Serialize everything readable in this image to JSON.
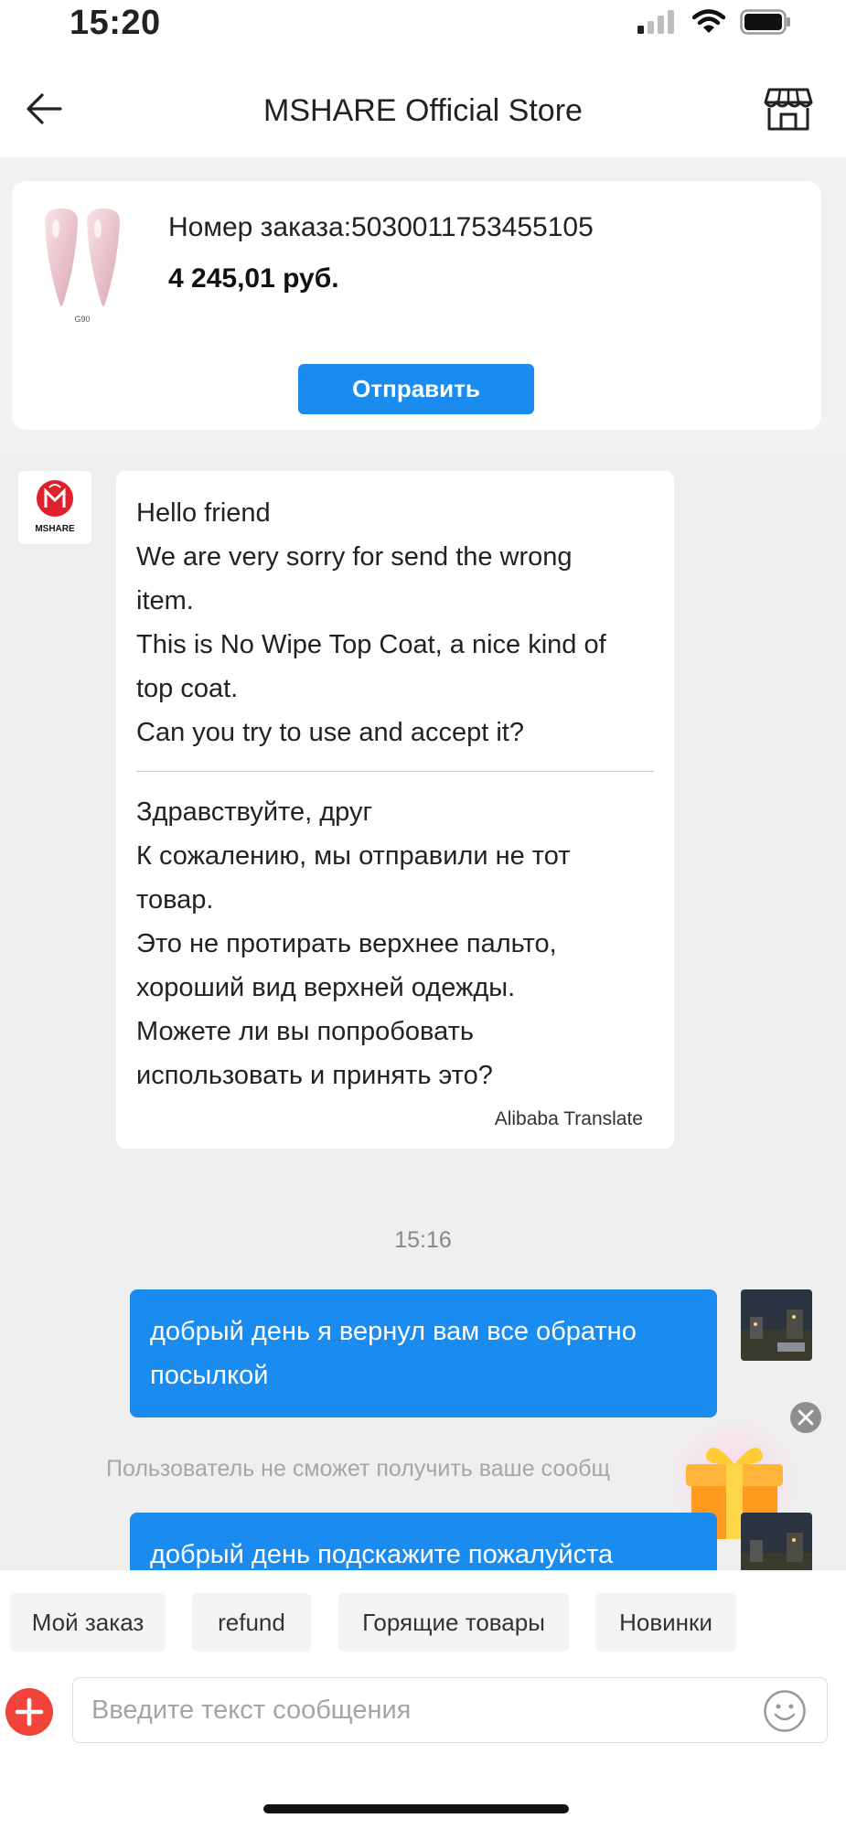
{
  "status_bar": {
    "time": "15:20"
  },
  "header": {
    "title": "MSHARE Official Store"
  },
  "order": {
    "thumb_caption": "G90",
    "number_label": "Номер заказа:5030011753455105",
    "price": "4 245,01 руб.",
    "send_label": "Отправить"
  },
  "seller": {
    "avatar_text": "MSHARE",
    "message": {
      "original": [
        "Hello friend",
        "We are very sorry for send the wrong",
        "item.",
        "This is No Wipe Top Coat, a nice kind of",
        "top coat.",
        "Can you try to use and accept it?"
      ],
      "translated": [
        "Здравствуйте, друг",
        "К сожалению, мы отправили не тот",
        "товар.",
        "Это не протирать верхнее пальто,",
        "хороший вид верхней одежды.",
        "Можете ли вы попробовать",
        "использовать и принять это?"
      ],
      "credit": "Alibaba Translate"
    }
  },
  "chat": {
    "timestamp": "15:16",
    "user_messages": [
      {
        "lines": [
          "добрый день я вернул вам все обратно",
          "посылкой"
        ]
      },
      {
        "lines": [
          "добрый день подскажите пожалуйста",
          ""
        ]
      }
    ],
    "system_notice": "Пользователь не сможет получить ваше сообщ"
  },
  "quick_replies": [
    "Мой заказ",
    "refund",
    "Горящие товары",
    "Новинки"
  ],
  "input": {
    "placeholder": "Введите текст сообщения"
  },
  "colors": {
    "accent": "#1a8cf0",
    "plus": "#f0443a",
    "background": "#efefef"
  },
  "icons": [
    "back-arrow-icon",
    "store-icon",
    "plus-icon",
    "emoji-icon",
    "gift-icon",
    "close-icon",
    "wifi-icon",
    "battery-icon",
    "signal-icon"
  ]
}
